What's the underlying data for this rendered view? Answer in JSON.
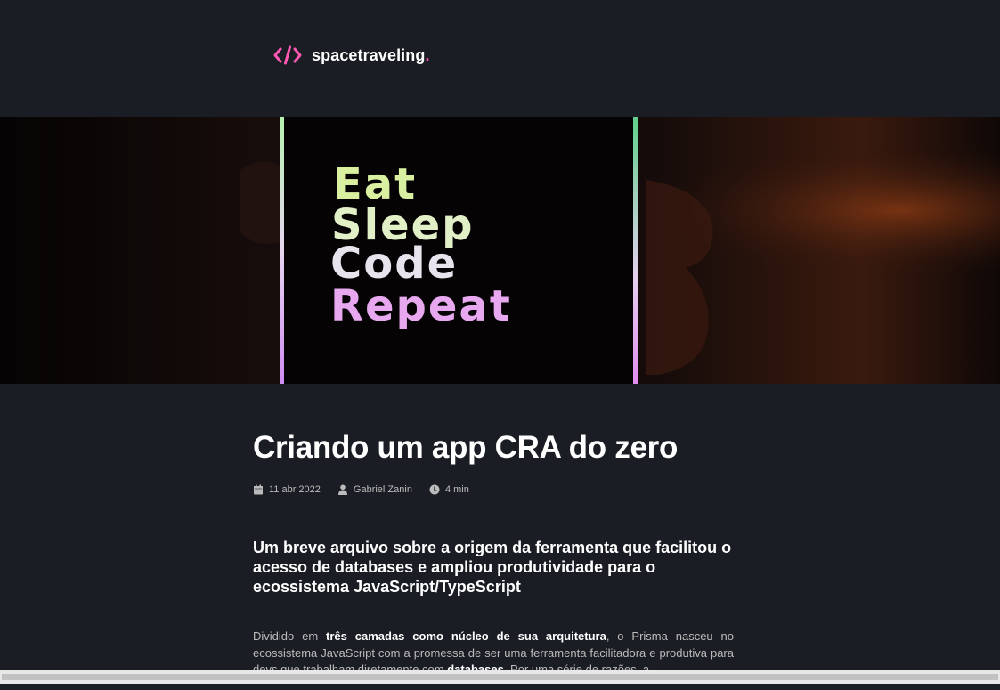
{
  "brand": {
    "name": "spacetraveling",
    "dot": "."
  },
  "banner": {
    "lines": [
      "Eat",
      "Sleep",
      "Code",
      "Repeat"
    ]
  },
  "post": {
    "title": "Criando um app CRA do zero",
    "meta": {
      "date": "11 abr 2022",
      "author": "Gabriel Zanin",
      "reading_time": "4 min"
    },
    "heading": "Um breve arquivo sobre a origem da ferramenta que facilitou o acesso de databases e ampliou produtividade para o ecossistema JavaScript/TypeScript",
    "body": {
      "p1": "Dividido em ",
      "b1": "três camadas como núcleo de sua arquitetura",
      "p2": ", o Prisma nasceu no ecossistema JavaScript com a promessa de ser uma ferramenta facilitadora e produtiva para devs que trabalham diretamente com ",
      "b2": "databases",
      "p3": ". Por uma série de razões, a"
    }
  },
  "colors": {
    "background": "#1a1d23",
    "accent": "#ff57b2",
    "text": "#ffffff",
    "muted": "#bbbbbb"
  },
  "icons": {
    "logo": "code-brackets-icon",
    "date": "calendar-icon",
    "author": "user-icon",
    "time": "clock-icon"
  }
}
